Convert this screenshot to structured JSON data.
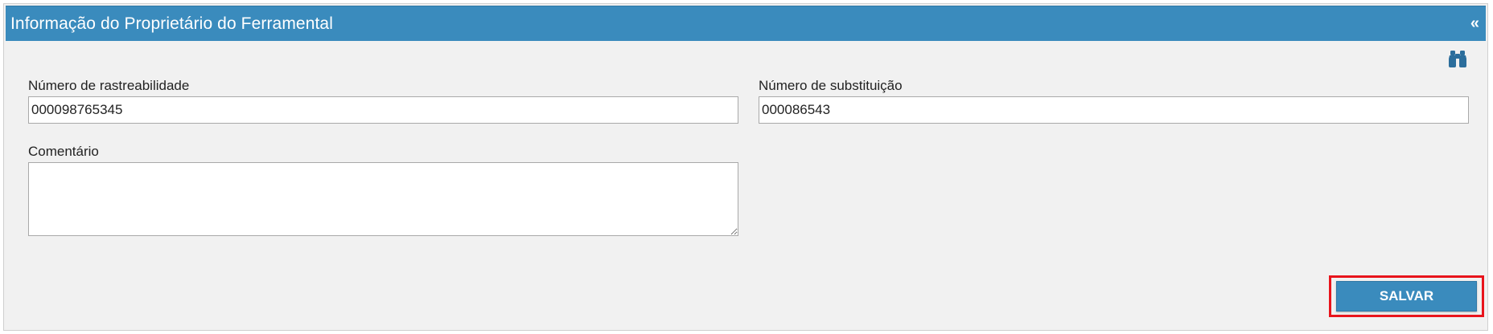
{
  "panel": {
    "title": "Informação do Proprietário do Ferramental",
    "collapse_glyph": "«",
    "colors": {
      "header": "#3a8bbd",
      "highlight": "#e8141c"
    }
  },
  "toolbar": {
    "search_icon": "binoculars-icon"
  },
  "form": {
    "traceability": {
      "label": "Número de rastreabilidade",
      "value": "000098765345"
    },
    "substitution": {
      "label": "Número de substituição",
      "value": "000086543"
    },
    "comment": {
      "label": "Comentário",
      "value": ""
    }
  },
  "actions": {
    "save_label": "SALVAR"
  }
}
